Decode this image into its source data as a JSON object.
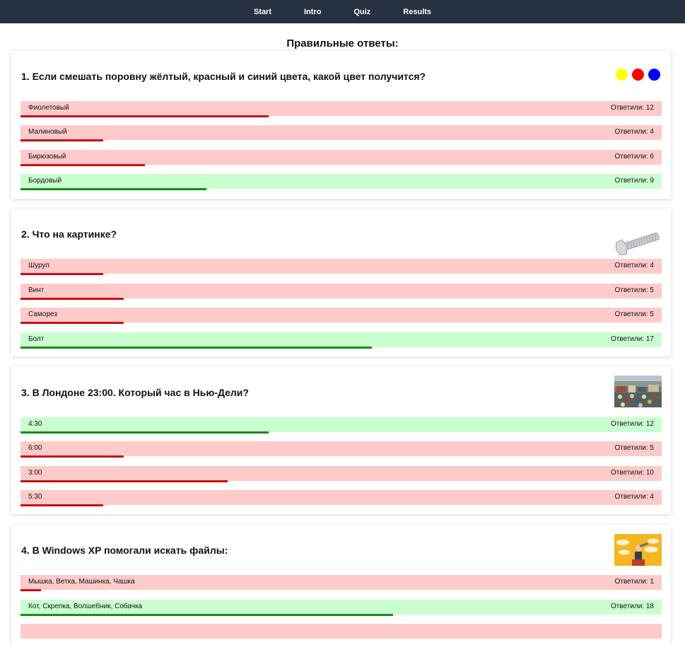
{
  "nav": {
    "items": [
      "Start",
      "Intro",
      "Quiz",
      "Results"
    ]
  },
  "page_title": "Правильные ответы:",
  "colors": {
    "wrong_bg": "#ffcaca",
    "right_bg": "#caffcf",
    "wrong_bar": "#c51111",
    "right_bar": "#198a1a",
    "nav_bg": "#263142"
  },
  "answers_label_prefix": "Ответили: ",
  "questions": [
    {
      "text": "1. Если смешать поровну жёлтый, красный и синий цвета, какой цвет получится?",
      "image": "color-dots",
      "answers": [
        {
          "label": "Фиолетовый",
          "count": 12,
          "count_text": "Ответили: 12",
          "correct": false
        },
        {
          "label": "Малиновый",
          "count": 4,
          "count_text": "Ответили: 4",
          "correct": false
        },
        {
          "label": "Бирюзовый",
          "count": 6,
          "count_text": "Ответили: 6",
          "correct": false
        },
        {
          "label": "Бордовый",
          "count": 9,
          "count_text": "Ответили: 9",
          "correct": true
        }
      ]
    },
    {
      "text": "2. Что на картинке?",
      "image": "bolt-image",
      "answers": [
        {
          "label": "Шуруп",
          "count": 4,
          "count_text": "Ответили: 4",
          "correct": false
        },
        {
          "label": "Винт",
          "count": 5,
          "count_text": "Ответили: 5",
          "correct": false
        },
        {
          "label": "Саморез",
          "count": 5,
          "count_text": "Ответили: 5",
          "correct": false
        },
        {
          "label": "Болт",
          "count": 17,
          "count_text": "Ответили: 17",
          "correct": true
        }
      ]
    },
    {
      "text": "3. В Лондоне 23:00. Который час в Нью-Дели?",
      "image": "crowd-photo",
      "answers": [
        {
          "label": "4:30",
          "count": 12,
          "count_text": "Ответили: 12",
          "correct": true
        },
        {
          "label": "6:00",
          "count": 5,
          "count_text": "Ответили: 5",
          "correct": false
        },
        {
          "label": "3:00",
          "count": 10,
          "count_text": "Ответили: 10",
          "correct": false
        },
        {
          "label": "5:30",
          "count": 4,
          "count_text": "Ответили: 4",
          "correct": false
        }
      ]
    },
    {
      "text": "4. В Windows XP помогали искать файлы:",
      "image": "spyglass-illustration",
      "answers": [
        {
          "label": "Мышка, Ветка, Машинка, Чашка",
          "count": 1,
          "count_text": "Ответили: 1",
          "correct": false
        },
        {
          "label": "Кот, Скрепка, Волшебник, Собачка",
          "count": 18,
          "count_text": "Ответили: 18",
          "correct": true
        }
      ]
    }
  ]
}
